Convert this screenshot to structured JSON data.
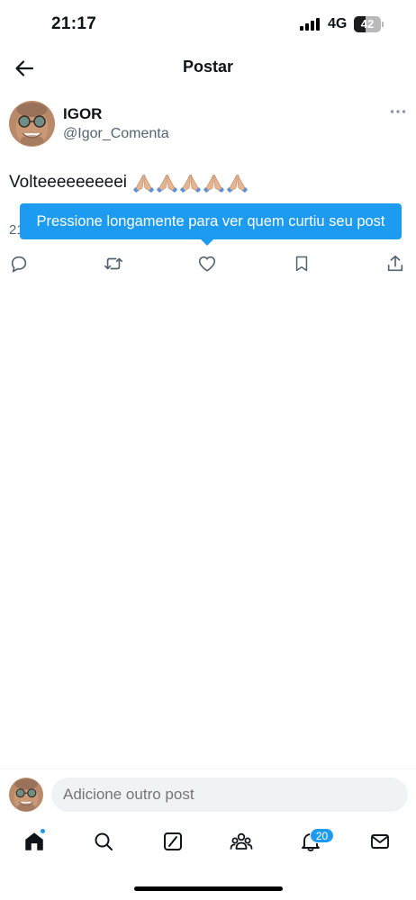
{
  "status_bar": {
    "time": "21:17",
    "network": "4G",
    "battery": "42",
    "battery_level": 0.42
  },
  "header": {
    "title": "Postar",
    "back_icon": "arrow-left-icon"
  },
  "post": {
    "author_name": "IGOR",
    "author_handle": "@Igor_Comenta",
    "text": "Volteeeeeeeeei",
    "emojis": [
      "🙏🏼",
      "🙏🏼",
      "🙏🏼",
      "🙏🏼",
      "🙏🏼"
    ],
    "meta_fragment": "21",
    "more_icon": "more-horizontal-icon"
  },
  "tooltip": {
    "text": "Pressione longamente para ver quem curtiu seu post"
  },
  "actions": [
    {
      "name": "reply",
      "icon": "reply-icon"
    },
    {
      "name": "repost",
      "icon": "repost-icon"
    },
    {
      "name": "like",
      "icon": "heart-icon"
    },
    {
      "name": "bookmark",
      "icon": "bookmark-icon"
    },
    {
      "name": "share",
      "icon": "share-icon"
    }
  ],
  "composer": {
    "placeholder": "Adicione outro post"
  },
  "tabbar": {
    "items": [
      {
        "name": "home",
        "icon": "home-icon",
        "badge_dot": true
      },
      {
        "name": "search",
        "icon": "search-icon"
      },
      {
        "name": "grok",
        "icon": "grok-icon"
      },
      {
        "name": "communities",
        "icon": "communities-icon"
      },
      {
        "name": "notifications",
        "icon": "bell-icon",
        "badge": "20"
      },
      {
        "name": "messages",
        "icon": "mail-icon"
      }
    ]
  },
  "colors": {
    "accent": "#1d9bf0",
    "text": "#0f1419",
    "secondary": "#536471",
    "input_bg": "#eff3f4"
  }
}
